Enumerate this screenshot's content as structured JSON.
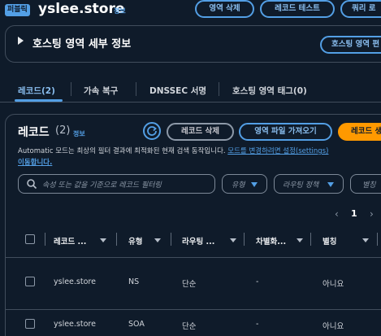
{
  "header": {
    "badge": "퍼블릭",
    "zone_name": "yslee.store",
    "info": "정보",
    "actions": [
      "영역 삭제",
      "레코드 테스트",
      "쿼리 로"
    ]
  },
  "details": {
    "title": "호스팅 영역 세부 정보",
    "edit_button": "호스팅 영역 편"
  },
  "tabs": [
    {
      "label": "레코드(2)",
      "active": true
    },
    {
      "label": "가속 복구",
      "active": false
    },
    {
      "label": "DNSSEC 서명",
      "active": false
    },
    {
      "label": "호스팅 영역 태그(0)",
      "active": false
    }
  ],
  "records": {
    "title": "레코드",
    "count": "(2)",
    "info": "정보",
    "delete_button": "레코드 삭제",
    "import_button": "영역 파일 가져오기",
    "create_button": "레코드 생성",
    "description": "Automatic 모드는 최상의 필터 결과에 최적화된 현재 검색 동작입니다.",
    "description_link": "모드를 변경하려면 설정(settings)",
    "description_link_cont": "이동합니다.",
    "search_placeholder": "속성 또는 값을 기준으로 레코드 필터링",
    "filters": [
      "유형",
      "라우팅 정책",
      "별칭"
    ],
    "pagination": {
      "prev": "‹",
      "page": "1",
      "next": "›"
    },
    "columns": [
      "레코드 ...",
      "유형",
      "라우팅 ...",
      "차별화...",
      "별칭"
    ],
    "rows": [
      {
        "name": "yslee.store",
        "type": "NS",
        "routing": "단순",
        "diff": "-",
        "alias": "아니요"
      },
      {
        "name": "yslee.store",
        "type": "SOA",
        "routing": "단순",
        "diff": "-",
        "alias": "아니요"
      }
    ]
  },
  "colors": {
    "background": "#0f1b2a",
    "accent": "#539fe5",
    "primary_button": "#ff9900"
  },
  "icons": {
    "details_toggle": "caret-right-icon",
    "refresh": "refresh-icon",
    "search": "search-icon"
  }
}
